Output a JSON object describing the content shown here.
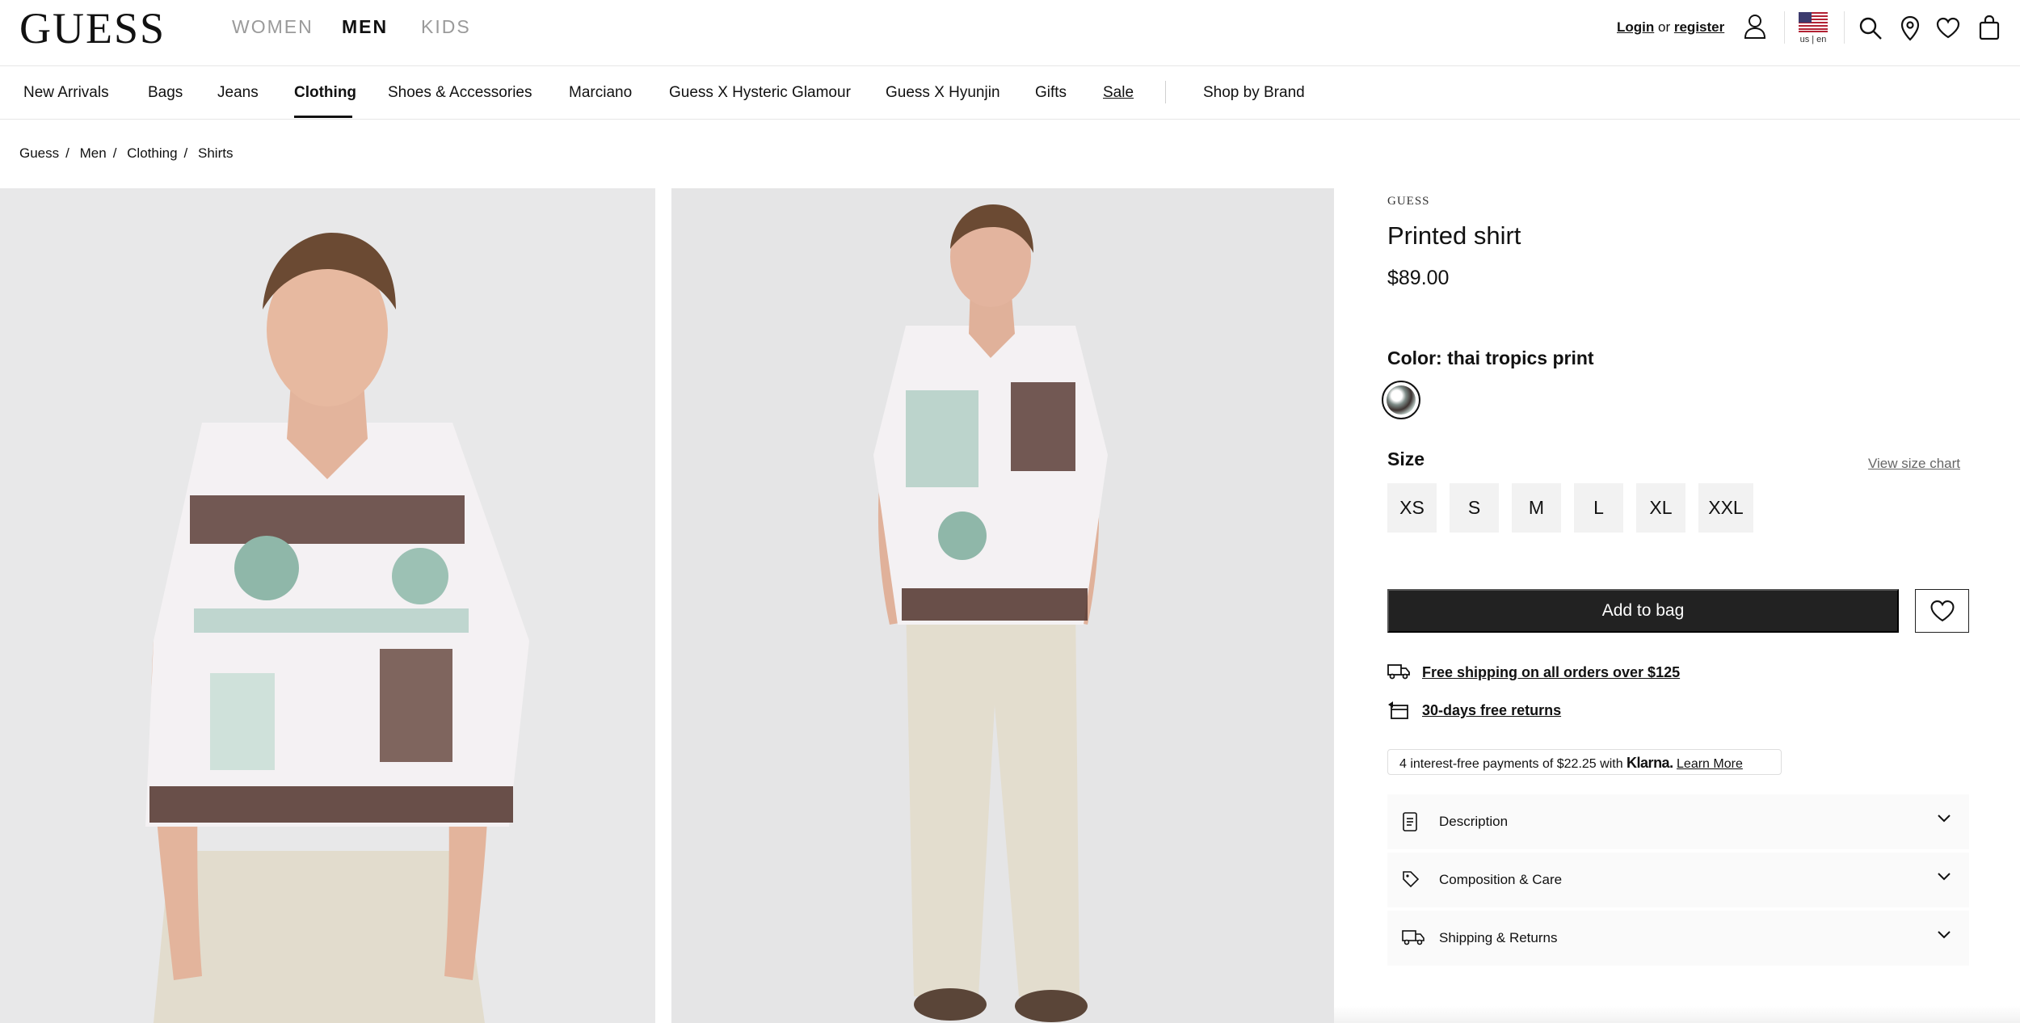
{
  "header": {
    "logo": "GUESS",
    "departments": [
      {
        "label": "WOMEN",
        "active": false
      },
      {
        "label": "MEN",
        "active": true
      },
      {
        "label": "KIDS",
        "active": false
      }
    ],
    "auth": {
      "login": "Login",
      "or": "or",
      "register": "register"
    },
    "locale": "us | en",
    "icons": [
      "user-icon",
      "us-flag-icon",
      "search-icon",
      "store-locator-icon",
      "wishlist-icon",
      "bag-icon"
    ]
  },
  "category_nav": {
    "items": [
      "New Arrivals",
      "Bags",
      "Jeans",
      "Clothing",
      "Shoes & Accessories",
      "Marciano",
      "Guess X Hysteric Glamour",
      "Guess X Hyunjin",
      "Gifts",
      "Sale",
      "Shop by Brand"
    ],
    "active": "Clothing"
  },
  "breadcrumb": [
    "Guess",
    "Men",
    "Clothing",
    "Shirts"
  ],
  "product": {
    "brand": "GUESS",
    "name": "Printed shirt",
    "price": "$89.00",
    "color_label": "Color: thai tropics print",
    "size_label": "Size",
    "size_chart": "View size chart",
    "sizes": [
      "XS",
      "S",
      "M",
      "L",
      "XL",
      "XXL"
    ],
    "add_to_bag": "Add to bag",
    "perks": [
      {
        "icon": "truck-icon",
        "text": "Free shipping on all orders over $125"
      },
      {
        "icon": "return-box-icon",
        "text": "30-days free returns"
      }
    ],
    "klarna": {
      "prefix": "4 interest-free payments of $22.25 with",
      "brand": "Klarna.",
      "link": "Learn More"
    },
    "accordions": [
      {
        "icon": "document-icon",
        "label": "Description"
      },
      {
        "icon": "tag-icon",
        "label": "Composition & Care"
      },
      {
        "icon": "truck-icon",
        "label": "Shipping & Returns"
      }
    ]
  },
  "colors": {
    "text": "#111111",
    "muted": "#9a9a9a",
    "button_dark": "#222222",
    "size_bg": "#f2f2f2",
    "photo_bg": "#e7e7e8"
  }
}
